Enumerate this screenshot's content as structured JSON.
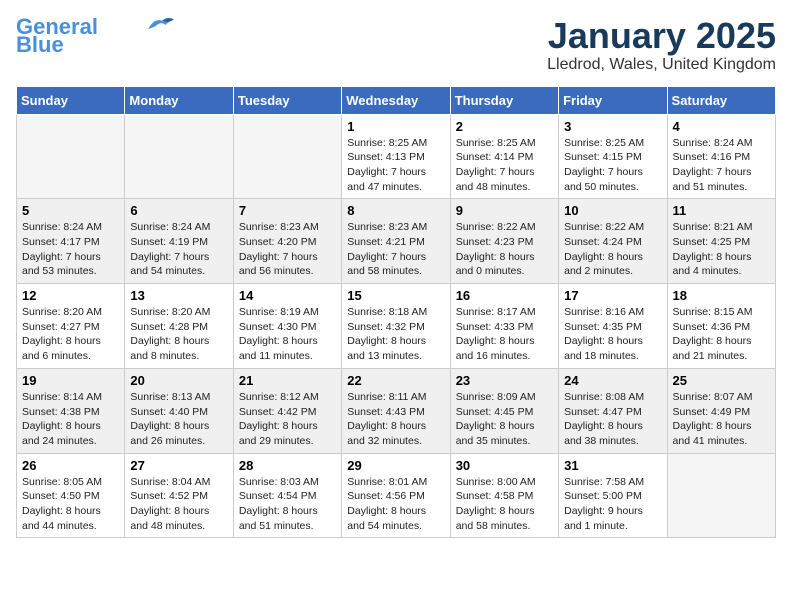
{
  "logo": {
    "line1": "General",
    "line2": "Blue"
  },
  "header": {
    "title": "January 2025",
    "subtitle": "Lledrod, Wales, United Kingdom"
  },
  "days_of_week": [
    "Sunday",
    "Monday",
    "Tuesday",
    "Wednesday",
    "Thursday",
    "Friday",
    "Saturday"
  ],
  "weeks": [
    [
      {
        "day": "",
        "info": ""
      },
      {
        "day": "",
        "info": ""
      },
      {
        "day": "",
        "info": ""
      },
      {
        "day": "1",
        "info": "Sunrise: 8:25 AM\nSunset: 4:13 PM\nDaylight: 7 hours\nand 47 minutes."
      },
      {
        "day": "2",
        "info": "Sunrise: 8:25 AM\nSunset: 4:14 PM\nDaylight: 7 hours\nand 48 minutes."
      },
      {
        "day": "3",
        "info": "Sunrise: 8:25 AM\nSunset: 4:15 PM\nDaylight: 7 hours\nand 50 minutes."
      },
      {
        "day": "4",
        "info": "Sunrise: 8:24 AM\nSunset: 4:16 PM\nDaylight: 7 hours\nand 51 minutes."
      }
    ],
    [
      {
        "day": "5",
        "info": "Sunrise: 8:24 AM\nSunset: 4:17 PM\nDaylight: 7 hours\nand 53 minutes."
      },
      {
        "day": "6",
        "info": "Sunrise: 8:24 AM\nSunset: 4:19 PM\nDaylight: 7 hours\nand 54 minutes."
      },
      {
        "day": "7",
        "info": "Sunrise: 8:23 AM\nSunset: 4:20 PM\nDaylight: 7 hours\nand 56 minutes."
      },
      {
        "day": "8",
        "info": "Sunrise: 8:23 AM\nSunset: 4:21 PM\nDaylight: 7 hours\nand 58 minutes."
      },
      {
        "day": "9",
        "info": "Sunrise: 8:22 AM\nSunset: 4:23 PM\nDaylight: 8 hours\nand 0 minutes."
      },
      {
        "day": "10",
        "info": "Sunrise: 8:22 AM\nSunset: 4:24 PM\nDaylight: 8 hours\nand 2 minutes."
      },
      {
        "day": "11",
        "info": "Sunrise: 8:21 AM\nSunset: 4:25 PM\nDaylight: 8 hours\nand 4 minutes."
      }
    ],
    [
      {
        "day": "12",
        "info": "Sunrise: 8:20 AM\nSunset: 4:27 PM\nDaylight: 8 hours\nand 6 minutes."
      },
      {
        "day": "13",
        "info": "Sunrise: 8:20 AM\nSunset: 4:28 PM\nDaylight: 8 hours\nand 8 minutes."
      },
      {
        "day": "14",
        "info": "Sunrise: 8:19 AM\nSunset: 4:30 PM\nDaylight: 8 hours\nand 11 minutes."
      },
      {
        "day": "15",
        "info": "Sunrise: 8:18 AM\nSunset: 4:32 PM\nDaylight: 8 hours\nand 13 minutes."
      },
      {
        "day": "16",
        "info": "Sunrise: 8:17 AM\nSunset: 4:33 PM\nDaylight: 8 hours\nand 16 minutes."
      },
      {
        "day": "17",
        "info": "Sunrise: 8:16 AM\nSunset: 4:35 PM\nDaylight: 8 hours\nand 18 minutes."
      },
      {
        "day": "18",
        "info": "Sunrise: 8:15 AM\nSunset: 4:36 PM\nDaylight: 8 hours\nand 21 minutes."
      }
    ],
    [
      {
        "day": "19",
        "info": "Sunrise: 8:14 AM\nSunset: 4:38 PM\nDaylight: 8 hours\nand 24 minutes."
      },
      {
        "day": "20",
        "info": "Sunrise: 8:13 AM\nSunset: 4:40 PM\nDaylight: 8 hours\nand 26 minutes."
      },
      {
        "day": "21",
        "info": "Sunrise: 8:12 AM\nSunset: 4:42 PM\nDaylight: 8 hours\nand 29 minutes."
      },
      {
        "day": "22",
        "info": "Sunrise: 8:11 AM\nSunset: 4:43 PM\nDaylight: 8 hours\nand 32 minutes."
      },
      {
        "day": "23",
        "info": "Sunrise: 8:09 AM\nSunset: 4:45 PM\nDaylight: 8 hours\nand 35 minutes."
      },
      {
        "day": "24",
        "info": "Sunrise: 8:08 AM\nSunset: 4:47 PM\nDaylight: 8 hours\nand 38 minutes."
      },
      {
        "day": "25",
        "info": "Sunrise: 8:07 AM\nSunset: 4:49 PM\nDaylight: 8 hours\nand 41 minutes."
      }
    ],
    [
      {
        "day": "26",
        "info": "Sunrise: 8:05 AM\nSunset: 4:50 PM\nDaylight: 8 hours\nand 44 minutes."
      },
      {
        "day": "27",
        "info": "Sunrise: 8:04 AM\nSunset: 4:52 PM\nDaylight: 8 hours\nand 48 minutes."
      },
      {
        "day": "28",
        "info": "Sunrise: 8:03 AM\nSunset: 4:54 PM\nDaylight: 8 hours\nand 51 minutes."
      },
      {
        "day": "29",
        "info": "Sunrise: 8:01 AM\nSunset: 4:56 PM\nDaylight: 8 hours\nand 54 minutes."
      },
      {
        "day": "30",
        "info": "Sunrise: 8:00 AM\nSunset: 4:58 PM\nDaylight: 8 hours\nand 58 minutes."
      },
      {
        "day": "31",
        "info": "Sunrise: 7:58 AM\nSunset: 5:00 PM\nDaylight: 9 hours\nand 1 minute."
      },
      {
        "day": "",
        "info": ""
      }
    ]
  ]
}
